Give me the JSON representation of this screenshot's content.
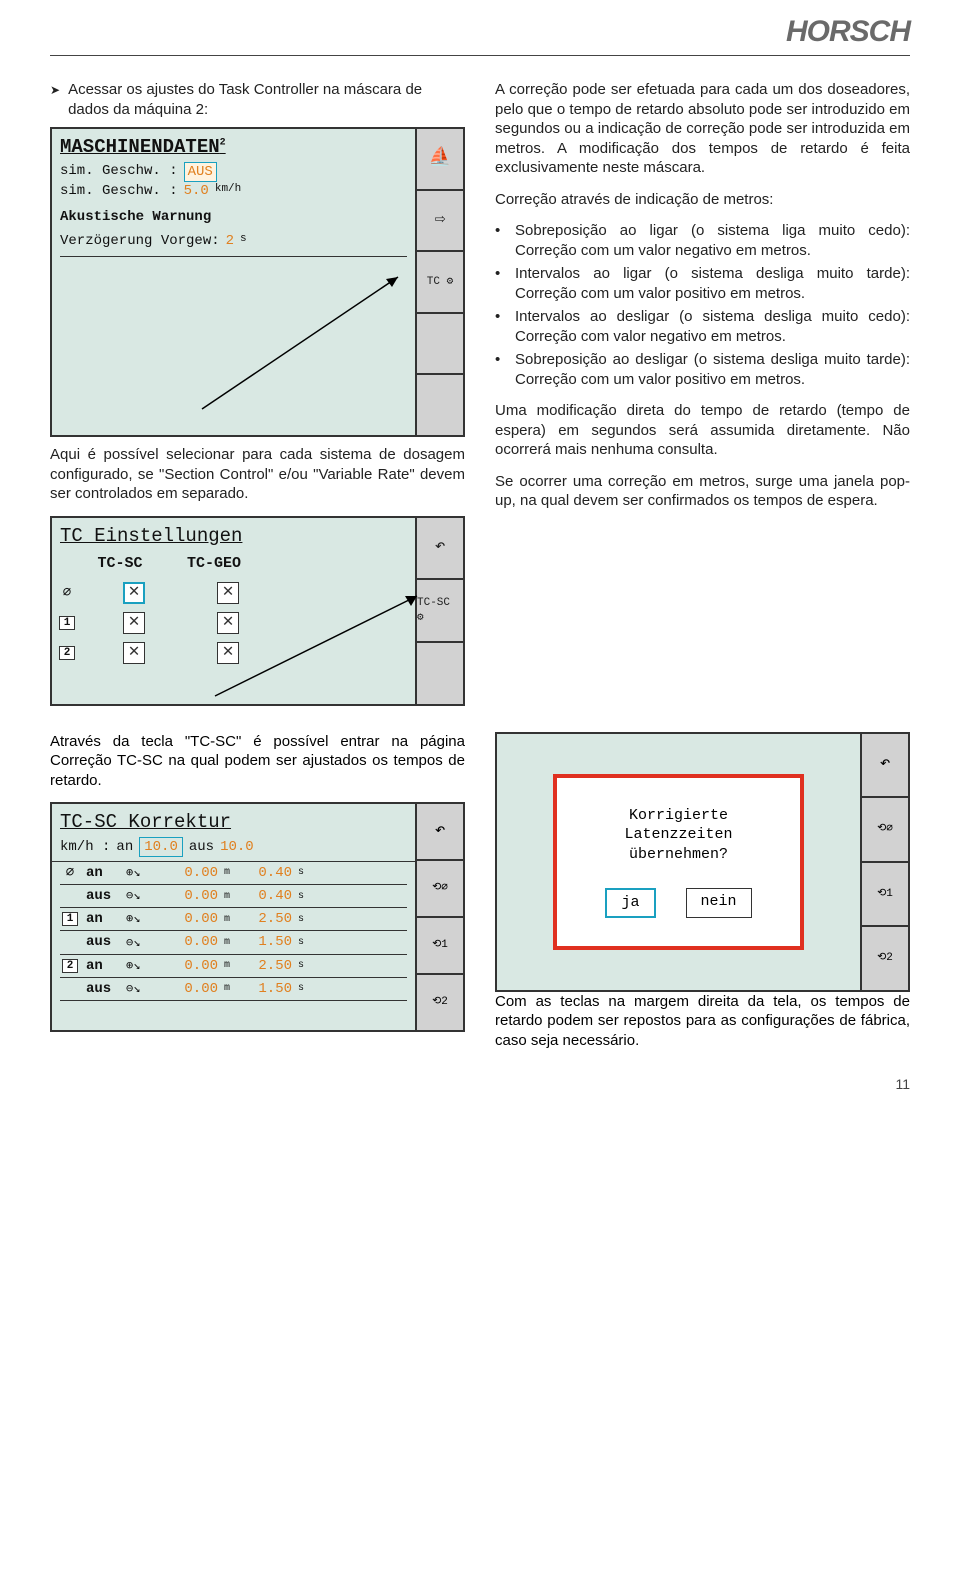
{
  "brand": "HORSCH",
  "page_number": "11",
  "left": {
    "head": "Acessar os ajustes do Task Controller na máscara de dados da máquina 2:",
    "mid": "Aqui é possível selecionar para cada sistema de dosagem configurado, se \"Section Control\" e/ou \"Variable Rate\" devem ser controlados em separado.",
    "tcsc_intro": "Através da tecla \"TC-SC\" é possível entrar na página Correção TC-SC na qual podem ser ajustados os tempos de retardo."
  },
  "right": {
    "p1": "A correção pode ser efetuada para cada um dos doseadores, pelo que o tempo de retardo absoluto pode ser introduzido em segundos ou a indicação de correção pode ser introduzida em metros. A modificação dos tempos de retardo é feita exclusivamente neste máscara.",
    "p2": "Correção através de indicação de metros:",
    "bullets": [
      "Sobreposição ao ligar (o sistema liga muito cedo): Correção com um valor negativo em metros.",
      "Intervalos ao ligar (o sistema desliga muito tarde): Correção com um valor positivo em metros.",
      "Intervalos ao desligar (o sistema desliga muito cedo): Correção com valor negativo em metros.",
      "Sobreposição ao desligar (o sistema desliga muito tarde): Correção com um valor positivo em metros."
    ],
    "p3": "Uma modificação direta do tempo de retardo (tempo de espera) em segundos será assumida diretamente. Não ocorrerá mais nenhuma consulta.",
    "p4": "Se ocorrer uma correção em metros, surge uma janela pop-up, na qual devem ser confirmados os tempos de espera.",
    "p5": "Com as teclas na margem direita da tela, os tempos de retardo podem ser repostos para as configurações de fábrica, caso seja necessário."
  },
  "panel_md": {
    "title": "MASCHINENDATEN",
    "sup": "2",
    "r1_label": "sim. Geschw. :",
    "r1_val": "AUS",
    "r2_label": "sim. Geschw. :",
    "r2_val": "5.0",
    "r2_unit": "km/h",
    "sect": "Akustische Warnung",
    "r3_label": "Verzögerung Vorgew:",
    "r3_val": "2",
    "r3_unit": "s",
    "side": {
      "b1": "⛵",
      "b2": "⇨",
      "b3": "TC ⚙"
    }
  },
  "panel_tc": {
    "title": "TC Einstellungen",
    "col1": "TC-SC",
    "col2": "TC-GEO",
    "rows": [
      {
        "icon": "⌀",
        "c1": true,
        "c2": true,
        "c1_sel": true
      },
      {
        "icon": "1",
        "c1": true,
        "c2": true
      },
      {
        "icon": "2",
        "c1": true,
        "c2": true
      }
    ],
    "side": {
      "b1": "↶",
      "b2": "TC-SC ⚙"
    }
  },
  "panel_kr": {
    "title": "TC-SC Korrektur",
    "kmh_label": "km/h :",
    "an_label": "an",
    "an_val": "10.0",
    "aus_label": "aus",
    "aus_val": "10.0",
    "rows": [
      {
        "group": "⌀",
        "lab": "an",
        "ic": "⊕↘",
        "m": "0.00",
        "s": "0.40"
      },
      {
        "group": "",
        "lab": "aus",
        "ic": "⊖↘",
        "m": "0.00",
        "s": "0.40"
      },
      {
        "group": "1",
        "lab": "an",
        "ic": "⊕↘",
        "m": "0.00",
        "s": "2.50"
      },
      {
        "group": "",
        "lab": "aus",
        "ic": "⊖↘",
        "m": "0.00",
        "s": "1.50"
      },
      {
        "group": "2",
        "lab": "an",
        "ic": "⊕↘",
        "m": "0.00",
        "s": "2.50"
      },
      {
        "group": "",
        "lab": "aus",
        "ic": "⊖↘",
        "m": "0.00",
        "s": "1.50"
      }
    ],
    "unit_m": "m",
    "unit_s": "s",
    "side": {
      "b1": "↶",
      "b2": "⟲⌀",
      "b3": "⟲1",
      "b4": "⟲2"
    }
  },
  "panel_popup": {
    "line1": "Korrigierte",
    "line2": "Latenzzeiten",
    "line3": "übernehmen?",
    "yes": "ja",
    "no": "nein",
    "side": {
      "b1": "↶",
      "b2": "⟲⌀",
      "b3": "⟲1",
      "b4": "⟲2"
    }
  }
}
